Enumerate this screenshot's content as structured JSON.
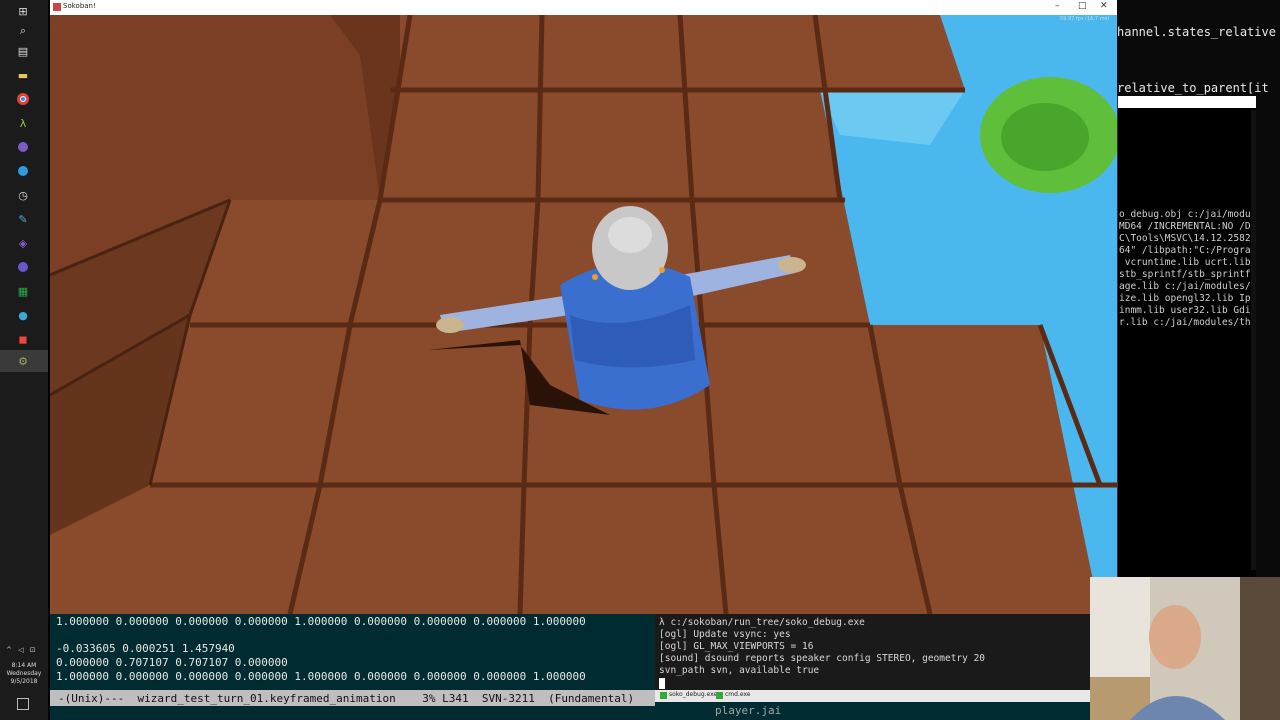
{
  "game_window": {
    "title": "Sokoban!",
    "fps_overlay": "59.97 fps (16.7 ms)"
  },
  "taskbar": {
    "icons": [
      "windows-start-icon",
      "search-icon",
      "task-view-icon",
      "file-explorer-icon",
      "chrome-icon",
      "lambda-terminal-icon",
      "app-icon",
      "browser-icon",
      "clock-icon",
      "tool-icon",
      "visual-studio-icon",
      "app-icon-2",
      "spreadsheet-icon",
      "app-icon-3",
      "app-icon-4",
      "settings-icon"
    ],
    "time": "8:14 AM",
    "day": "Wednesday",
    "date": "9/5/2018"
  },
  "editor_right": {
    "lines": [
      "hannel.states_relative",
      "relative_to_parent[it"
    ]
  },
  "cmd_right": {
    "lines": [
      "o_debug.obj c:/jai/modu",
      "MD64 /INCREMENTAL:NO /D",
      "C\\Tools\\MSVC\\14.12.2582",
      "64\" /libpath:\"C:/Progra",
      " vcruntime.lib ucrt.lib",
      "stb_sprintf/stb_sprintf",
      "age.lib c:/jai/modules/",
      "ize.lib opengl32.lib Ip",
      "inmm.lib user32.lib Gdi",
      "r.lib c:/jai/modules/th"
    ]
  },
  "emacs": {
    "lines": [
      "1.000000 0.000000 0.000000 0.000000 1.000000 0.000000 0.000000 0.000000 1.000000",
      "",
      "-0.033605 0.000251 1.457940",
      "0.000000 0.707107 0.707107 0.000000",
      "1.000000 0.000000 0.000000 0.000000 1.000000 0.000000 0.000000 0.000000 1.000000"
    ],
    "modeline": "-(Unix)---  wizard_test_turn_01.keyframed_animation    3% L341  SVN-3211  (Fundamental)"
  },
  "cmd": {
    "lines": [
      "λ c:/sokoban/run_tree/soko_debug.exe",
      "[ogl] Update vsync: yes",
      "[ogl] GL_MAX_VIEWPORTS = 16",
      "[sound] dsound reports speaker config STEREO, geometry 20",
      "svn_path svn, available true"
    ],
    "tabs": [
      "soko_debug.exe",
      "cmd.exe"
    ],
    "tail_modeline": "player.jai"
  },
  "colors": {
    "floor": "#8a4a2c",
    "grout": "#5a2a14",
    "water": "#4ab8ee",
    "emacs_bg": "#002b30",
    "modeline_bg": "#bfbfbf"
  }
}
